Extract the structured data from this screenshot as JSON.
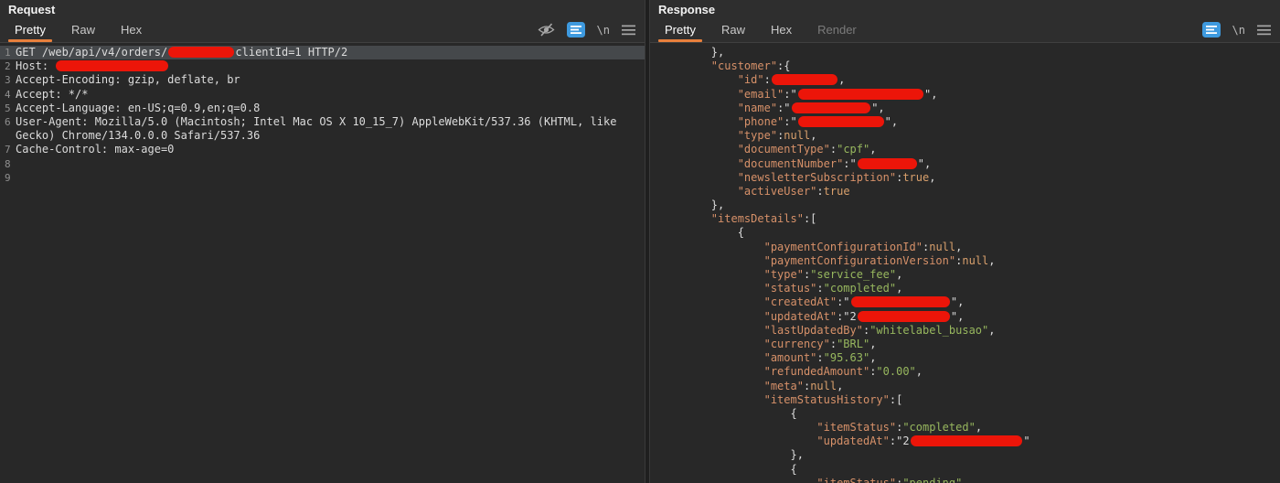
{
  "colors": {
    "accent": "#e8803c",
    "redact": "#ec1509",
    "json_key": "#d79169",
    "json_string": "#97b75e",
    "json_literal": "#d9a06c",
    "editor_text": "#dcdcdc"
  },
  "glyphs": {
    "newline": "\\n"
  },
  "request": {
    "title": "Request",
    "tabs": [
      "Pretty",
      "Raw",
      "Hex"
    ],
    "active_tab": "Pretty",
    "toolbar_icons": [
      "eye-slash",
      "syntax-highlight",
      "newline",
      "menu"
    ],
    "lines": [
      {
        "no": "1",
        "hl": true,
        "seg": [
          {
            "t": "GET /web/api/v4/orders/"
          },
          {
            "redact": 10
          },
          {
            "t": "clientId=1 HTTP/2"
          }
        ]
      },
      {
        "no": "2",
        "seg": [
          {
            "t": "Host: "
          },
          {
            "redact": 17
          }
        ]
      },
      {
        "no": "3",
        "seg": [
          {
            "t": "Accept-Encoding: gzip, deflate, br"
          }
        ]
      },
      {
        "no": "4",
        "seg": [
          {
            "t": "Accept: */*"
          }
        ]
      },
      {
        "no": "5",
        "seg": [
          {
            "t": "Accept-Language: en-US;q=0.9,en;q=0.8"
          }
        ]
      },
      {
        "no": "6",
        "seg": [
          {
            "t": "User-Agent: Mozilla/5.0 (Macintosh; Intel Mac OS X 10_15_7) AppleWebKit/537.36 (KHTML, like"
          }
        ]
      },
      {
        "no": "",
        "seg": [
          {
            "t": "Gecko) Chrome/134.0.0.0 Safari/537.36"
          }
        ]
      },
      {
        "no": "7",
        "seg": [
          {
            "t": "Cache-Control: max-age=0"
          }
        ]
      },
      {
        "no": "8",
        "seg": []
      },
      {
        "no": "9",
        "seg": []
      }
    ]
  },
  "response": {
    "title": "Response",
    "tabs": [
      "Pretty",
      "Raw",
      "Hex",
      "Render"
    ],
    "active_tab": "Pretty",
    "disabled_tabs": [
      "Render"
    ],
    "toolbar_icons": [
      "syntax-highlight",
      "newline",
      "menu"
    ],
    "lines": [
      {
        "seg": [
          {
            "t": "        },"
          }
        ]
      },
      {
        "seg": [
          {
            "t": "        "
          },
          {
            "t": "\"customer\"",
            "c": "k"
          },
          {
            "t": ":{"
          }
        ]
      },
      {
        "seg": [
          {
            "t": "            "
          },
          {
            "t": "\"id\"",
            "c": "k"
          },
          {
            "t": ":"
          },
          {
            "redact": 10
          },
          {
            "t": ","
          }
        ]
      },
      {
        "seg": [
          {
            "t": "            "
          },
          {
            "t": "\"email\"",
            "c": "k"
          },
          {
            "t": ":\""
          },
          {
            "redact": 19
          },
          {
            "t": "\","
          }
        ]
      },
      {
        "seg": [
          {
            "t": "            "
          },
          {
            "t": "\"name\"",
            "c": "k"
          },
          {
            "t": ":\""
          },
          {
            "redact": 12
          },
          {
            "t": "\","
          }
        ]
      },
      {
        "seg": [
          {
            "t": "            "
          },
          {
            "t": "\"phone\"",
            "c": "k"
          },
          {
            "t": ":\""
          },
          {
            "redact": 13
          },
          {
            "t": "\","
          }
        ]
      },
      {
        "seg": [
          {
            "t": "            "
          },
          {
            "t": "\"type\"",
            "c": "k"
          },
          {
            "t": ":"
          },
          {
            "t": "null",
            "c": "l"
          },
          {
            "t": ","
          }
        ]
      },
      {
        "seg": [
          {
            "t": "            "
          },
          {
            "t": "\"documentType\"",
            "c": "k"
          },
          {
            "t": ":"
          },
          {
            "t": "\"cpf\"",
            "c": "s"
          },
          {
            "t": ","
          }
        ]
      },
      {
        "seg": [
          {
            "t": "            "
          },
          {
            "t": "\"documentNumber\"",
            "c": "k"
          },
          {
            "t": ":\""
          },
          {
            "redact": 9
          },
          {
            "t": "\","
          }
        ]
      },
      {
        "seg": [
          {
            "t": "            "
          },
          {
            "t": "\"newsletterSubscription\"",
            "c": "k"
          },
          {
            "t": ":"
          },
          {
            "t": "true",
            "c": "l"
          },
          {
            "t": ","
          }
        ]
      },
      {
        "seg": [
          {
            "t": "            "
          },
          {
            "t": "\"activeUser\"",
            "c": "k"
          },
          {
            "t": ":"
          },
          {
            "t": "true",
            "c": "l"
          }
        ]
      },
      {
        "seg": [
          {
            "t": "        },"
          }
        ]
      },
      {
        "seg": [
          {
            "t": "        "
          },
          {
            "t": "\"itemsDetails\"",
            "c": "k"
          },
          {
            "t": ":["
          }
        ]
      },
      {
        "seg": [
          {
            "t": "            {"
          }
        ]
      },
      {
        "seg": [
          {
            "t": "                "
          },
          {
            "t": "\"paymentConfigurationId\"",
            "c": "k"
          },
          {
            "t": ":"
          },
          {
            "t": "null",
            "c": "l"
          },
          {
            "t": ","
          }
        ]
      },
      {
        "seg": [
          {
            "t": "                "
          },
          {
            "t": "\"paymentConfigurationVersion\"",
            "c": "k"
          },
          {
            "t": ":"
          },
          {
            "t": "null",
            "c": "l"
          },
          {
            "t": ","
          }
        ]
      },
      {
        "seg": [
          {
            "t": "                "
          },
          {
            "t": "\"type\"",
            "c": "k"
          },
          {
            "t": ":"
          },
          {
            "t": "\"service_fee\"",
            "c": "s"
          },
          {
            "t": ","
          }
        ]
      },
      {
        "seg": [
          {
            "t": "                "
          },
          {
            "t": "\"status\"",
            "c": "k"
          },
          {
            "t": ":"
          },
          {
            "t": "\"completed\"",
            "c": "s"
          },
          {
            "t": ","
          }
        ]
      },
      {
        "seg": [
          {
            "t": "                "
          },
          {
            "t": "\"createdAt\"",
            "c": "k"
          },
          {
            "t": ":\""
          },
          {
            "redact": 15
          },
          {
            "t": "\","
          }
        ]
      },
      {
        "seg": [
          {
            "t": "                "
          },
          {
            "t": "\"updatedAt\"",
            "c": "k"
          },
          {
            "t": ":\"2"
          },
          {
            "redact": 14
          },
          {
            "t": "\","
          }
        ]
      },
      {
        "seg": [
          {
            "t": "                "
          },
          {
            "t": "\"lastUpdatedBy\"",
            "c": "k"
          },
          {
            "t": ":"
          },
          {
            "t": "\"whitelabel_busao\"",
            "c": "s"
          },
          {
            "t": ","
          }
        ]
      },
      {
        "seg": [
          {
            "t": "                "
          },
          {
            "t": "\"currency\"",
            "c": "k"
          },
          {
            "t": ":"
          },
          {
            "t": "\"BRL\"",
            "c": "s"
          },
          {
            "t": ","
          }
        ]
      },
      {
        "seg": [
          {
            "t": "                "
          },
          {
            "t": "\"amount\"",
            "c": "k"
          },
          {
            "t": ":"
          },
          {
            "t": "\"95.63\"",
            "c": "s"
          },
          {
            "t": ","
          }
        ]
      },
      {
        "seg": [
          {
            "t": "                "
          },
          {
            "t": "\"refundedAmount\"",
            "c": "k"
          },
          {
            "t": ":"
          },
          {
            "t": "\"0.00\"",
            "c": "s"
          },
          {
            "t": ","
          }
        ]
      },
      {
        "seg": [
          {
            "t": "                "
          },
          {
            "t": "\"meta\"",
            "c": "k"
          },
          {
            "t": ":"
          },
          {
            "t": "null",
            "c": "l"
          },
          {
            "t": ","
          }
        ]
      },
      {
        "seg": [
          {
            "t": "                "
          },
          {
            "t": "\"itemStatusHistory\"",
            "c": "k"
          },
          {
            "t": ":["
          }
        ]
      },
      {
        "seg": [
          {
            "t": "                    {"
          }
        ]
      },
      {
        "seg": [
          {
            "t": "                        "
          },
          {
            "t": "\"itemStatus\"",
            "c": "k"
          },
          {
            "t": ":"
          },
          {
            "t": "\"completed\"",
            "c": "s"
          },
          {
            "t": ","
          }
        ]
      },
      {
        "seg": [
          {
            "t": "                        "
          },
          {
            "t": "\"updatedAt\"",
            "c": "k"
          },
          {
            "t": ":\"2"
          },
          {
            "redact": 17
          },
          {
            "t": "\""
          }
        ]
      },
      {
        "seg": [
          {
            "t": "                    },"
          }
        ]
      },
      {
        "seg": [
          {
            "t": "                    {"
          }
        ]
      },
      {
        "seg": [
          {
            "t": "                        "
          },
          {
            "t": "\"itemStatus\"",
            "c": "k"
          },
          {
            "t": ":"
          },
          {
            "t": "\"pending\"",
            "c": "s"
          }
        ]
      }
    ]
  }
}
